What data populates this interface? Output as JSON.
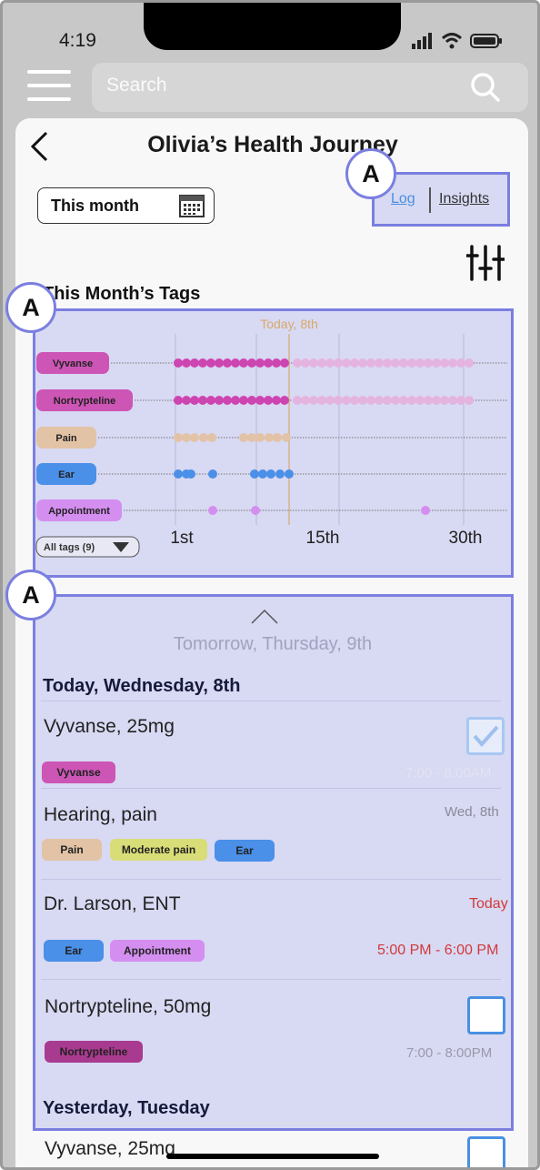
{
  "status_bar": {
    "time": "4:19"
  },
  "search": {
    "placeholder": "Search"
  },
  "header": {
    "title": "Olivia’s Health Journey"
  },
  "date_filter": {
    "label": "This month"
  },
  "view_tabs": {
    "log": "Log",
    "insights": "Insights"
  },
  "annotation_label": "A",
  "tags_section": {
    "title": "This Month’s Tags"
  },
  "timeline": {
    "today_label": "Today, 8th",
    "x_labels": [
      "1st",
      "15th",
      "30th"
    ],
    "all_tags_label": "All tags (9)",
    "rows": [
      {
        "tag": "Vyvanse",
        "color": "#cc55b5"
      },
      {
        "tag": "Nortrypteline",
        "color": "#cc55b5"
      },
      {
        "tag": "Pain",
        "color": "#e3c3a6"
      },
      {
        "tag": "Ear",
        "color": "#4a8fe8"
      },
      {
        "tag": "Appointment",
        "color": "#d48ef0"
      }
    ]
  },
  "log": {
    "tomorrow_label": "Tomorrow, Thursday, 9th",
    "today_header": "Today, Wednesday, 8th",
    "yesterday_header": "Yesterday, Tuesday",
    "entries": [
      {
        "title": "Vyvanse, 25mg",
        "chips": [
          "Vyvanse"
        ],
        "time": "7:00 - 8:00AM",
        "checked": true
      },
      {
        "title": "Hearing, pain",
        "chips": [
          "Pain",
          "Moderate pain",
          "Ear"
        ],
        "time": "Wed, 8th"
      },
      {
        "title": "Dr. Larson, ENT",
        "chips": [
          "Ear",
          "Appointment"
        ],
        "date": "Today",
        "time": "5:00 PM - 6:00 PM"
      },
      {
        "title": "Nortrypteline, 50mg",
        "chips": [
          "Nortrypteline"
        ],
        "time": "7:00 - 8:00PM",
        "checked": false
      }
    ],
    "yesterday_entries": [
      {
        "title": "Vyvanse, 25mg",
        "checked": false
      }
    ]
  }
}
